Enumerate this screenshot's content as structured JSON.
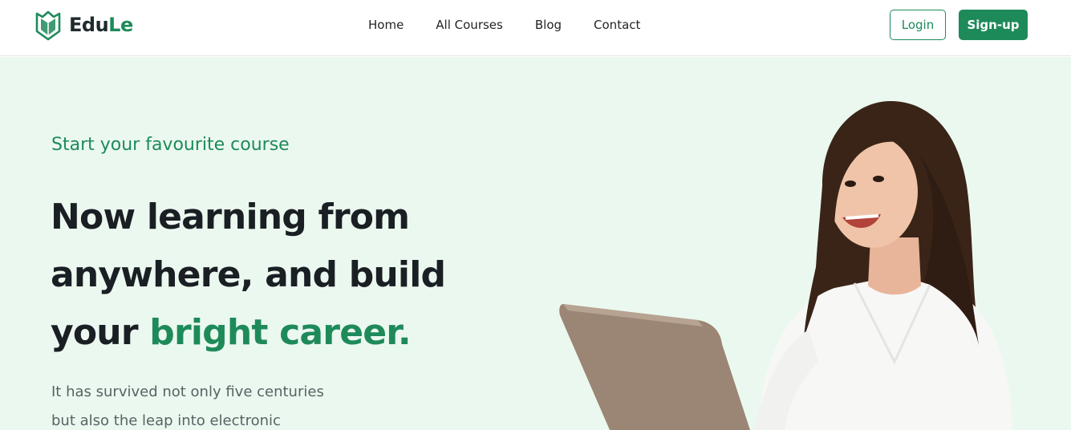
{
  "brand": {
    "name_part1": "Edu",
    "name_part2": "Le",
    "logo_icon": "book-shield-icon",
    "color": "#1e8a5a"
  },
  "nav": {
    "links": [
      "Home",
      "All Courses",
      "Blog",
      "Contact"
    ]
  },
  "auth": {
    "login_label": "Login",
    "signup_label": "Sign-up"
  },
  "hero": {
    "eyebrow": "Start your favourite course",
    "title_line1": "Now learning from",
    "title_line2": "anywhere, and build",
    "title_line3_prefix": "your ",
    "title_highlight": "bright career.",
    "description_line1": "It has survived not only five centuries",
    "description_line2": "but also the leap into electronic",
    "illustration": "woman-with-laptop-illustration"
  },
  "colors": {
    "accent": "#1e8a5a",
    "hero_bg": "#ebf8ef",
    "heading": "#1a1f24",
    "body_text": "#5a6264"
  }
}
